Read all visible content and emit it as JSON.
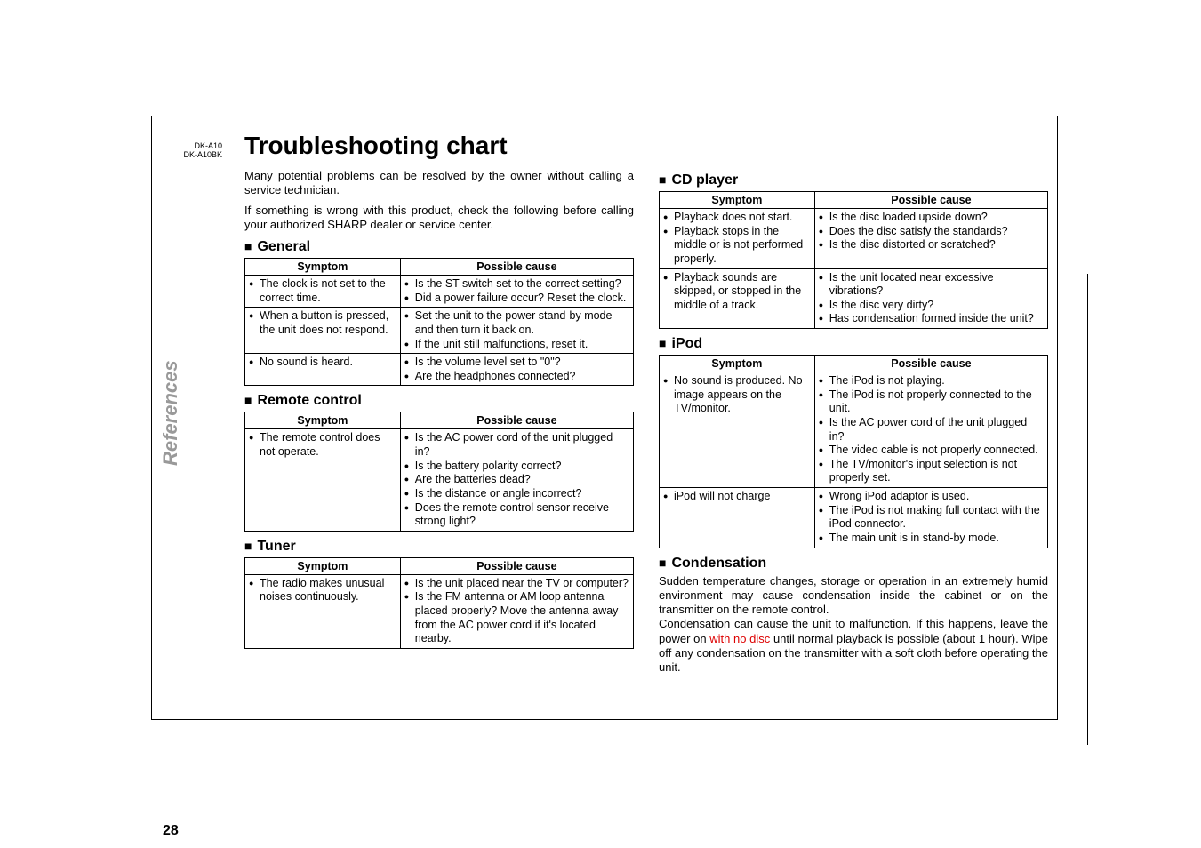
{
  "model": {
    "line1": "DK-A10",
    "line2": "DK-A10BK"
  },
  "side_tab": "References",
  "page_number": "28",
  "title": "Troubleshooting chart",
  "intro1": "Many potential problems can be resolved by the owner without calling a service technician.",
  "intro2": "If something is wrong with this product, check the following before calling your authorized SHARP dealer or service center.",
  "headers": {
    "symptom": "Symptom",
    "cause": "Possible cause"
  },
  "sections": {
    "general": {
      "title": "General",
      "rows": [
        {
          "symptom": [
            "The clock is not set to the correct time."
          ],
          "cause": [
            "Is the ST switch set to the correct setting?",
            "Did a power failure occur? Reset the clock."
          ]
        },
        {
          "symptom": [
            "When a button is pressed, the unit does not respond."
          ],
          "cause": [
            "Set the unit to the power stand-by mode and then turn it back on.",
            "If the unit still malfunctions, reset it."
          ]
        },
        {
          "symptom": [
            "No sound is heard."
          ],
          "cause": [
            "Is the volume level set to \"0\"?",
            "Are the headphones connected?"
          ]
        }
      ]
    },
    "remote": {
      "title": "Remote control",
      "rows": [
        {
          "symptom": [
            "The remote control does not operate."
          ],
          "cause": [
            "Is the AC power cord of the unit plugged in?",
            "Is the battery polarity correct?",
            "Are the batteries dead?",
            "Is the distance or angle incorrect?",
            "Does the remote control sensor receive strong light?"
          ]
        }
      ]
    },
    "tuner": {
      "title": "Tuner",
      "rows": [
        {
          "symptom": [
            "The radio makes unusual noises continuously."
          ],
          "cause": [
            "Is the unit placed near the TV or computer?",
            "Is the FM antenna or AM loop antenna placed properly? Move the antenna away from the AC power cord if it's located nearby."
          ]
        }
      ]
    },
    "cd": {
      "title": "CD player",
      "rows": [
        {
          "symptom": [
            "Playback does not start.",
            "Playback stops in the middle or is not performed properly."
          ],
          "cause": [
            "Is the disc loaded upside down?",
            "Does the disc satisfy the standards?",
            "Is the disc distorted or scratched?"
          ]
        },
        {
          "symptom": [
            "Playback sounds are skipped, or stopped in the middle of a track."
          ],
          "cause": [
            "Is the unit located near excessive vibrations?",
            "Is the disc very dirty?",
            "Has condensation formed inside the unit?"
          ]
        }
      ]
    },
    "ipod": {
      "title": "iPod",
      "rows": [
        {
          "symptom": [
            "No sound is produced. No image appears on the TV/monitor."
          ],
          "cause": [
            "The iPod is not playing.",
            "The iPod is not properly connected to the unit.",
            "Is the AC power cord of the unit plugged in?",
            "The video cable is not properly connected.",
            "The TV/monitor's input selection is not properly set."
          ]
        },
        {
          "symptom": [
            "iPod will not charge"
          ],
          "cause": [
            "Wrong iPod adaptor is used.",
            "The iPod is not making full contact with the iPod connector.",
            "The main unit is in stand-by mode."
          ]
        }
      ]
    },
    "condensation": {
      "title": "Condensation",
      "p1": "Sudden temperature changes, storage or operation in an extremely humid environment may cause condensation inside the cabinet or on the transmitter on the remote control.",
      "p2a": "Condensation can cause the unit to malfunction. If this happens, leave the power on ",
      "p2red": "with no disc",
      "p2b": " until normal playback is possible (about 1 hour). Wipe off any condensation on the transmitter with a soft cloth before operating the unit."
    }
  }
}
